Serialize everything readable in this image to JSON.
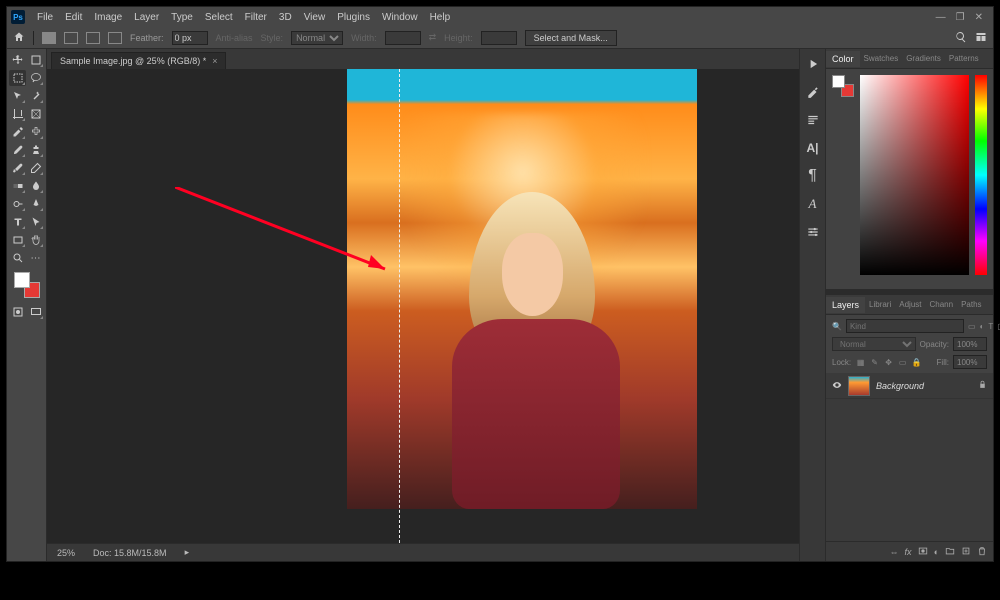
{
  "app": {
    "name": "Ps"
  },
  "menubar": {
    "items": [
      "File",
      "Edit",
      "Image",
      "Layer",
      "Type",
      "Select",
      "Filter",
      "3D",
      "View",
      "Plugins",
      "Window",
      "Help"
    ],
    "win": {
      "min": "—",
      "max": "❐",
      "close": "✕"
    }
  },
  "optionbar": {
    "feather_label": "Feather:",
    "feather_value": "0 px",
    "anti_alias": "Anti-alias",
    "style_label": "Style:",
    "style_value": "Normal",
    "width_label": "Width:",
    "height_label": "Height:",
    "select_and_mask": "Select and Mask..."
  },
  "document": {
    "tab_label": "Sample Image.jpg @ 25% (RGB/8) *",
    "zoom": "25%",
    "status_doc": "Doc: 15.8M/15.8M"
  },
  "vertical_bar": [
    "play",
    "brushes",
    "history",
    "type-a",
    "paragraph",
    "glyphs",
    "adjust"
  ],
  "panels": {
    "color_tabs": [
      "Color",
      "Swatches",
      "Gradients",
      "Patterns"
    ],
    "layers_tabs": [
      "Layers",
      "Librari",
      "Adjust",
      "Chann",
      "Paths"
    ],
    "layers": {
      "kind_search_placeholder": "Kind",
      "blend_mode": "Normal",
      "opacity_label": "Opacity:",
      "opacity_value": "100%",
      "lock_label": "Lock:",
      "fill_label": "Fill:",
      "fill_value": "100%",
      "items": [
        {
          "name": "Background",
          "locked": true,
          "visible": true
        }
      ]
    }
  },
  "tools": [
    [
      "move",
      "artboard"
    ],
    [
      "marquee-rect",
      "lasso"
    ],
    [
      "object-select",
      "magic-wand"
    ],
    [
      "crop",
      "frame"
    ],
    [
      "eyedropper",
      "spot-heal"
    ],
    [
      "brush",
      "clone-stamp"
    ],
    [
      "history-brush",
      "eraser"
    ],
    [
      "gradient",
      "blur"
    ],
    [
      "dodge",
      "pen"
    ],
    [
      "type",
      "path-select"
    ],
    [
      "rectangle",
      "hand"
    ],
    [
      "zoom",
      "edit-toolbar"
    ]
  ],
  "colors": {
    "foreground": "#ffffff",
    "background": "#e53935"
  }
}
